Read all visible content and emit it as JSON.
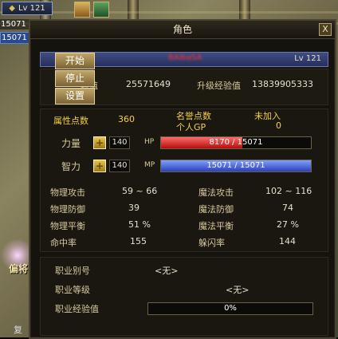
{
  "hud": {
    "level_label": "Lv 121",
    "hp_value": "15071",
    "mp_value": "15071",
    "side_text": "偏将",
    "side_text2": "复"
  },
  "window": {
    "title": "角色",
    "close_label": "X"
  },
  "character": {
    "name": "BAIbaSA",
    "level": "Lv 121"
  },
  "context_menu": [
    "开始",
    "停止",
    "设置"
  ],
  "experience": {
    "exp_label": "验值",
    "exp_value": "25571649",
    "next_label": "升级经验值",
    "next_value": "13839905333"
  },
  "attributes": {
    "points_label": "属性点数",
    "points_value": "360",
    "fame_label": "名誉点数",
    "fame_value": "未加入",
    "gp_label": "个人GP",
    "gp_value": "0"
  },
  "stats": {
    "strength": {
      "label": "力量",
      "value": "140",
      "bar_label": "HP",
      "bar_text": "8170 / 15071",
      "current": 8170,
      "max": 15071
    },
    "intelligence": {
      "label": "智力",
      "value": "140",
      "bar_label": "MP",
      "bar_text": "15071 / 15071",
      "current": 15071,
      "max": 15071
    }
  },
  "combat": [
    {
      "label": "物理攻击",
      "value": "59 ~ 66",
      "label2": "魔法攻击",
      "value2": "102 ~ 116"
    },
    {
      "label": "物理防御",
      "value": "39",
      "label2": "魔法防御",
      "value2": "74"
    },
    {
      "label": "物理平衡",
      "value": "51 %",
      "label2": "魔法平衡",
      "value2": "27 %"
    },
    {
      "label": "命中率",
      "value": "155",
      "label2": "躲闪率",
      "value2": "144"
    }
  ],
  "job": {
    "alias_label": "职业别号",
    "alias_value": "<无>",
    "level_label": "职业等级",
    "level_value": "<无>",
    "exp_label": "职业经验值",
    "exp_value": "0%",
    "exp_fraction": 0
  }
}
